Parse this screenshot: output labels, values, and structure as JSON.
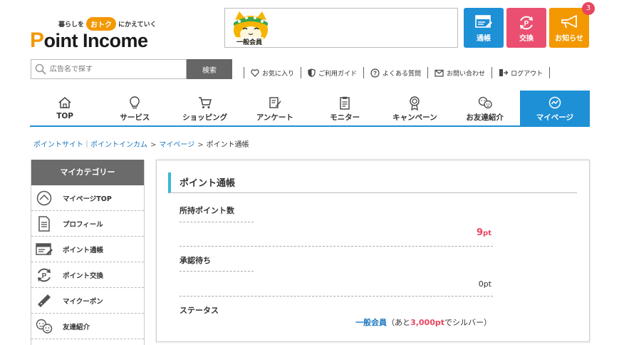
{
  "header": {
    "logo_tagline_pre": "暮らしを",
    "logo_tagline_badge": "おトク",
    "logo_tagline_post": "にかえていく",
    "logo_p": "P",
    "logo_rest": "oint Income",
    "member_rank_label": "一般会員",
    "buttons": [
      {
        "label": "通帳",
        "icon": "bank-passbook-icon",
        "color": "#1e90d6"
      },
      {
        "label": "交換",
        "icon": "point-exchange-icon",
        "color": "#ea4f72"
      },
      {
        "label": "お知らせ",
        "icon": "megaphone-icon",
        "color": "#f39800"
      }
    ],
    "notice_badge": "3"
  },
  "search": {
    "placeholder": "広告名で探す",
    "button_label": "検索"
  },
  "util_links": [
    {
      "label": "お気に入り",
      "icon": "heart-icon"
    },
    {
      "label": "ご利用ガイド",
      "icon": "shield-icon"
    },
    {
      "label": "よくある質問",
      "icon": "question-icon"
    },
    {
      "label": "お問い合わせ",
      "icon": "mail-icon"
    },
    {
      "label": "ログアウト",
      "icon": "logout-icon"
    }
  ],
  "gnav": [
    {
      "label": "TOP",
      "icon": "home-icon"
    },
    {
      "label": "サービス",
      "icon": "lightbulb-icon"
    },
    {
      "label": "ショッピング",
      "icon": "cart-icon"
    },
    {
      "label": "アンケート",
      "icon": "pencil-icon"
    },
    {
      "label": "モニター",
      "icon": "clipboard-icon"
    },
    {
      "label": "キャンペーン",
      "icon": "medal-icon"
    },
    {
      "label": "お友達紹介",
      "icon": "friends-icon"
    },
    {
      "label": "マイページ",
      "icon": "mypage-icon",
      "active": true
    }
  ],
  "breadcrumb": {
    "home": "ポイントサイト｜ポイントインカム",
    "mypage": "マイページ",
    "current": "ポイント通帳",
    "separator": ">"
  },
  "sidebar": {
    "title": "マイカテゴリー",
    "items": [
      {
        "label": "マイページTOP",
        "icon": "mypage-top-icon"
      },
      {
        "label": "プロフィール",
        "icon": "profile-document-icon"
      },
      {
        "label": "ポイント通帳",
        "icon": "bank-passbook-icon"
      },
      {
        "label": "ポイント交換",
        "icon": "point-exchange-icon"
      },
      {
        "label": "マイクーポン",
        "icon": "coupon-icon"
      },
      {
        "label": "友達紹介",
        "icon": "friends-icon"
      }
    ]
  },
  "panel": {
    "title": "ポイント通帳",
    "owned_label": "所持ポイント数",
    "owned_value": "9",
    "owned_unit": "pt",
    "pending_label": "承認待ち",
    "pending_value": "0pt",
    "status_label": "ステータス",
    "status_rank": "一般会員",
    "status_pre": "（あと",
    "status_amount": "3,000pt",
    "status_post": "でシルバー）"
  },
  "colors": {
    "accent_blue": "#1e90d6",
    "accent_pink": "#ea4f72",
    "accent_orange": "#f39800",
    "value_red": "#e8455f",
    "title_bar": "#3ab8d6"
  }
}
